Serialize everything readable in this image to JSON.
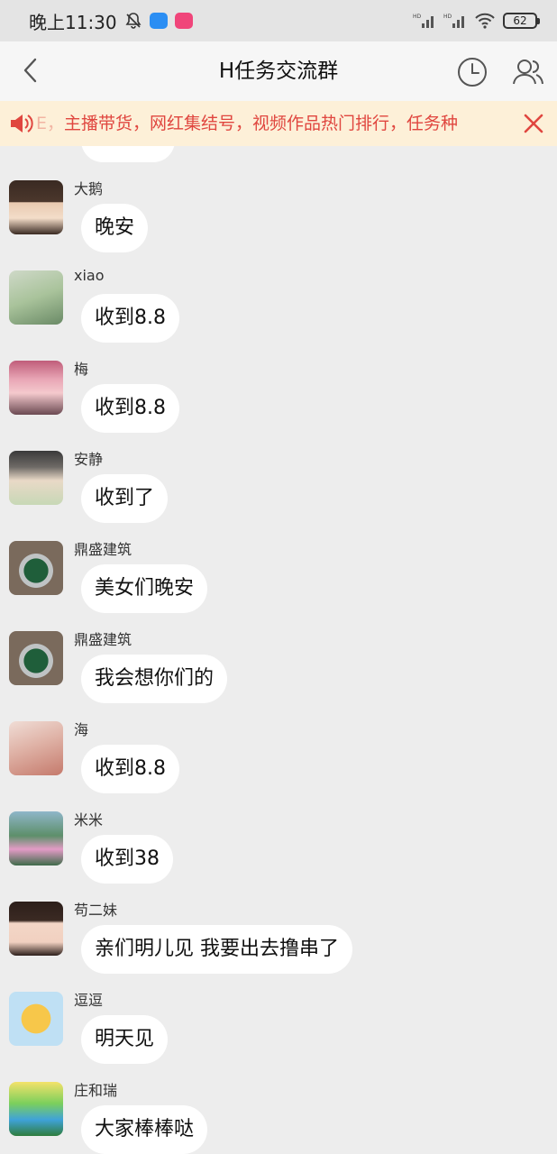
{
  "status_bar": {
    "time": "晚上11:30",
    "battery": "62",
    "network_labels": [
      "HD",
      "HD"
    ]
  },
  "header": {
    "title": "H任务交流群"
  },
  "notice": {
    "text": "主播带货，网红集结号，视频作品热门排行，任务种",
    "lead_fragment": "E，",
    "accent_color": "#e0463f",
    "background_color": "#fdf0d8"
  },
  "messages": [
    {
      "sender": "大鹅",
      "text": "晚安",
      "avatar": "portrait-avatar"
    },
    {
      "sender": "xiao",
      "text": "收到8.8",
      "avatar": "portrait-avatar"
    },
    {
      "sender": "梅",
      "text": "收到8.8",
      "avatar": "portrait-avatar"
    },
    {
      "sender": "安静",
      "text": "收到了",
      "avatar": "portrait-avatar"
    },
    {
      "sender": "鼎盛建筑",
      "text": "美女们晚安",
      "avatar": "watch-avatar"
    },
    {
      "sender": "鼎盛建筑",
      "text": "我会想你们的",
      "avatar": "watch-avatar"
    },
    {
      "sender": "海",
      "text": "收到8.8",
      "avatar": "portrait-avatar"
    },
    {
      "sender": "米米",
      "text": "收到38",
      "avatar": "lotus-avatar"
    },
    {
      "sender": "苟二妹",
      "text": "亲们明儿见 我要出去撸串了",
      "avatar": "portrait-avatar"
    },
    {
      "sender": "逗逗",
      "text": "明天见",
      "avatar": "cartoon-avatar"
    },
    {
      "sender": "庄和瑞",
      "text": "大家棒棒哒",
      "avatar": "cartoon-avatar"
    }
  ]
}
